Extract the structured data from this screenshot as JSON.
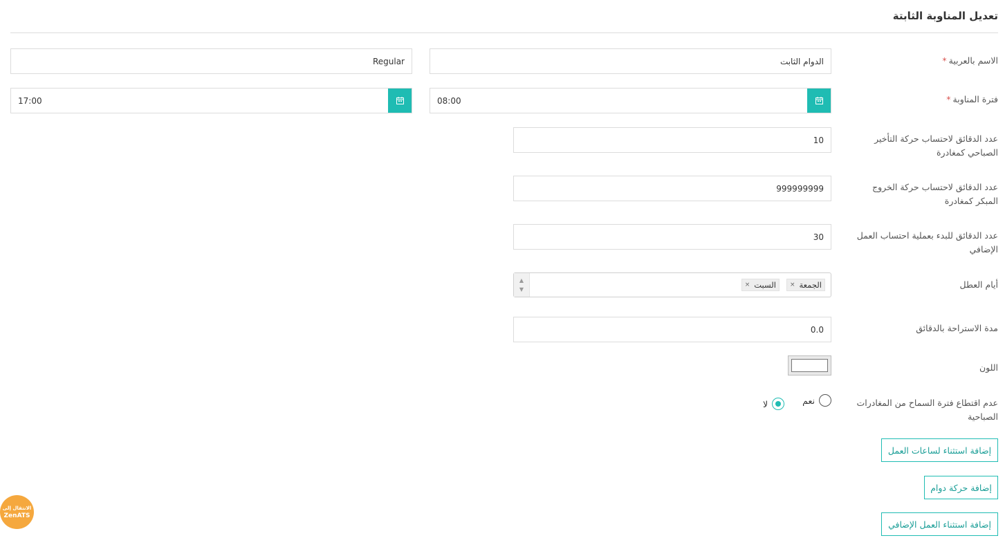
{
  "page": {
    "title": "تعديل المناوبة الثابتة"
  },
  "form": {
    "name": {
      "label": "الاسم بالعربية",
      "required_mark": "*",
      "value_ar": "الدوام الثابت",
      "value_en": "Regular"
    },
    "shift_period": {
      "label": "فترة المناوبة",
      "required_mark": "*",
      "start": "08:00",
      "end": "17:00"
    },
    "late_minutes": {
      "label": "عدد الدقائق لاحتساب حركة التأخير الصباحي كمغادرة",
      "value": "10"
    },
    "early_exit_minutes": {
      "label": "عدد الدقائق لاحتساب حركة الخروج المبكر كمغادرة",
      "value": "999999999"
    },
    "overtime_minutes": {
      "label": "عدد الدقائق للبدء بعملية احتساب العمل الإضافي",
      "value": "30"
    },
    "holidays": {
      "label": "أيام العطل",
      "tags": [
        "الجمعة",
        "السبت"
      ],
      "remove_symbol": "×"
    },
    "break_minutes": {
      "label": "مدة الاستراحة بالدقائق",
      "value": "0.0"
    },
    "color": {
      "label": "اللون",
      "value": "#ffffff"
    },
    "no_deduct_grace": {
      "label": "عدم اقتطاع فترة السماح من المغادرات الصباحية",
      "options": [
        {
          "label": "نعم",
          "selected": false
        },
        {
          "label": "لا",
          "selected": true
        }
      ]
    }
  },
  "actions": {
    "add_work_hours_exception": "إضافة استثناء لساعات العمل",
    "add_attendance_movement": "إضافة حركة دوام",
    "add_overtime_exception": "إضافة استثناء العمل الإضافي"
  },
  "badge": {
    "line1": "الانتقال إلى",
    "line2": "ZenATS",
    "color": "#f5a83e"
  },
  "colors": {
    "accent": "#1fbcb3",
    "required": "#d9534f"
  },
  "icons": {
    "calendar": "calendar-icon"
  }
}
